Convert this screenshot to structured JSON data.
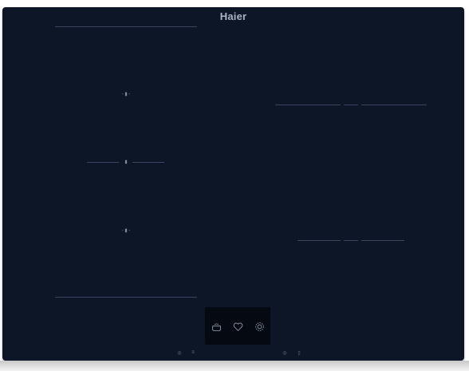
{
  "brand": {
    "name": "Haier"
  },
  "appliance": {
    "type": "induction-hob"
  },
  "colors": {
    "glass": "#0d1626",
    "lines": "#3a4660",
    "text": "#a9b3c4",
    "panel": "#050a12"
  },
  "zones": {
    "left_flex_area": {
      "markers": [
        {
          "icon": "zone-top-marker-icon"
        },
        {
          "icon": "zone-middle-marker-icon"
        },
        {
          "icon": "zone-bottom-marker-icon"
        }
      ]
    },
    "right_top_zone": {
      "icon": "right-top-zone-guide"
    },
    "right_bottom_zone": {
      "icon": "right-bottom-zone-guide"
    }
  },
  "control_panel": {
    "features": [
      {
        "icon": "pot-icon"
      },
      {
        "icon": "heart-icon"
      },
      {
        "icon": "gear-icon"
      }
    ]
  },
  "touch_controls": {
    "left": [
      {
        "icon": "power-icon"
      },
      {
        "icon": "lock-icon"
      }
    ],
    "right": [
      {
        "icon": "timer-icon"
      },
      {
        "icon": "pause-icon"
      }
    ]
  }
}
